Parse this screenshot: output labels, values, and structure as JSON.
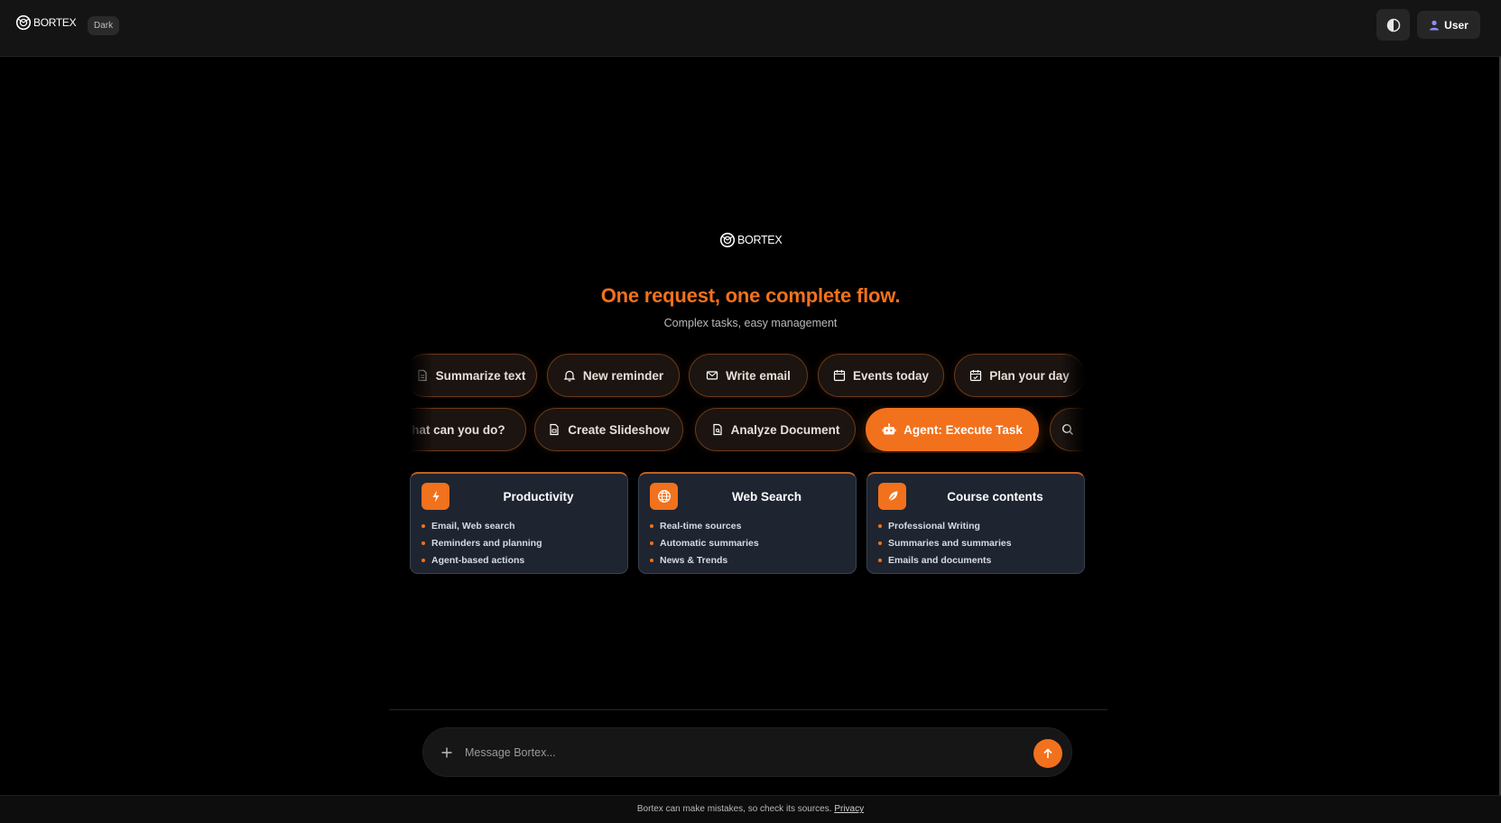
{
  "header": {
    "brand": "BORTEX",
    "theme_badge": "Dark",
    "theme_toggle_icon": "contrast-icon",
    "user_label": "User",
    "user_icon": "user-icon"
  },
  "hero": {
    "brand": "BORTEX",
    "title": "One request, one complete flow.",
    "subtitle": "Complex tasks, easy management"
  },
  "suggestions_row1": [
    {
      "label": "Summarize text",
      "icon": "file-text-icon"
    },
    {
      "label": "New reminder",
      "icon": "bell-icon"
    },
    {
      "label": "Write email",
      "icon": "mail-icon"
    },
    {
      "label": "Events today",
      "icon": "calendar-icon"
    },
    {
      "label": "Plan your day",
      "icon": "calendar-check-icon"
    }
  ],
  "suggestions_row2": [
    {
      "label": "What can you do?",
      "icon": ""
    },
    {
      "label": "Create Slideshow",
      "icon": "file-slides-icon"
    },
    {
      "label": "Analyze Document",
      "icon": "file-search-icon"
    },
    {
      "label": "Agent: Execute Task",
      "icon": "robot-icon",
      "active": true
    },
    {
      "label": "",
      "icon": "search-icon"
    }
  ],
  "cards": [
    {
      "title": "Productivity",
      "icon": "lightning-icon",
      "items": [
        "Email, Web search",
        "Reminders and planning",
        "Agent-based actions"
      ]
    },
    {
      "title": "Web Search",
      "icon": "globe-icon",
      "items": [
        "Real-time sources",
        "Automatic summaries",
        "News & Trends"
      ]
    },
    {
      "title": "Course contents",
      "icon": "feather-icon",
      "items": [
        "Professional Writing",
        "Summaries and summaries",
        "Emails and documents"
      ]
    }
  ],
  "composer": {
    "placeholder": "Message Bortex...",
    "attach_icon": "plus-icon",
    "send_icon": "arrow-up-icon"
  },
  "footer": {
    "notice": "Bortex can make mistakes, so check its sources.",
    "privacy_link": "Privacy"
  },
  "colors": {
    "accent": "#f2711c",
    "background": "#000000",
    "topbar": "#141414",
    "card": "#1e2530"
  }
}
